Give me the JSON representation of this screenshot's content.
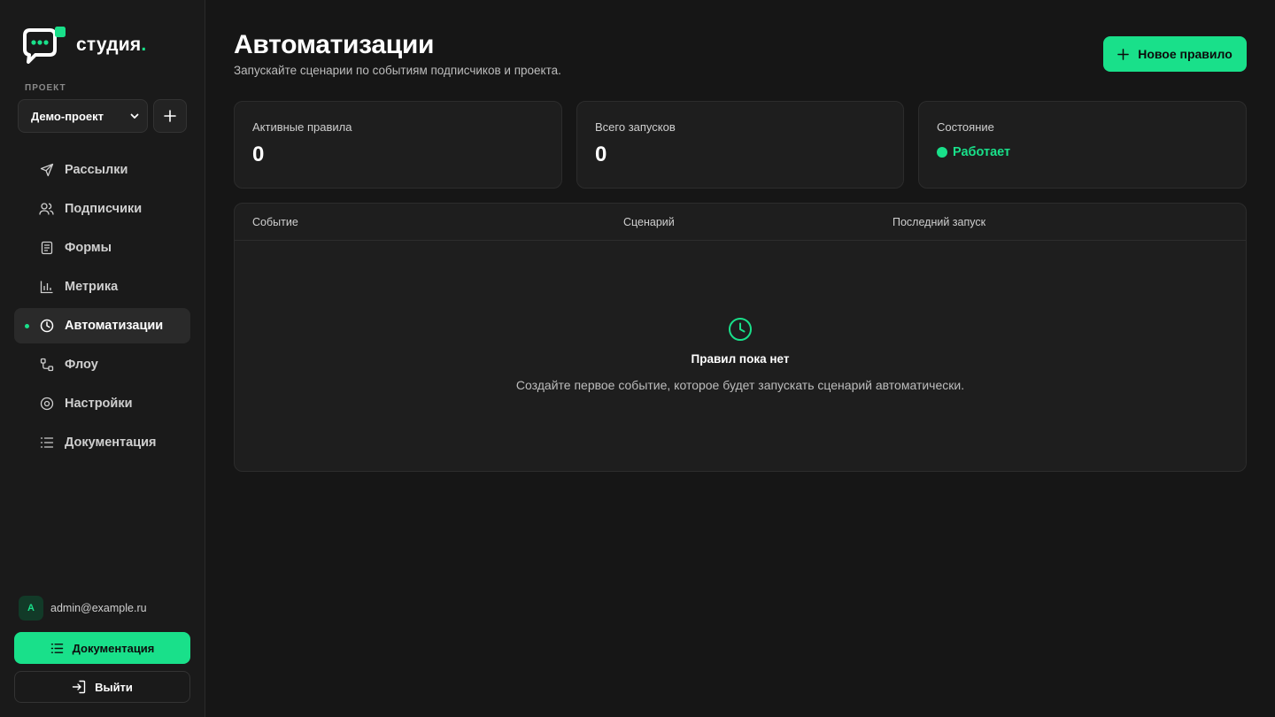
{
  "sidebar": {
    "logo_text": "студия",
    "logo_dot": ".",
    "project_label": "ПРОЕКТ",
    "project_selected": "Демо-проект",
    "nav": [
      {
        "label": "Рассылки",
        "icon": "send-icon"
      },
      {
        "label": "Подписчики",
        "icon": "users-icon"
      },
      {
        "label": "Формы",
        "icon": "form-icon"
      },
      {
        "label": "Метрика",
        "icon": "bar-chart-icon"
      },
      {
        "label": "Автоматизации",
        "icon": "clock-icon",
        "active": true
      },
      {
        "label": "Флоу",
        "icon": "flow-icon"
      },
      {
        "label": "Настройки",
        "icon": "settings-icon"
      },
      {
        "label": "Документация",
        "icon": "list-icon"
      }
    ],
    "user": {
      "initial": "A",
      "email": "admin@example.ru"
    },
    "docs_button": "Документация",
    "logout_button": "Выйти"
  },
  "header": {
    "title": "Автоматизации",
    "subtitle": "Запускайте сценарии по событиям подписчиков и проекта.",
    "new_rule_button": "Новое правило"
  },
  "stats": {
    "active_rules": {
      "label": "Активные правила",
      "value": "0"
    },
    "total_runs": {
      "label": "Всего запусков",
      "value": "0"
    },
    "state": {
      "label": "Состояние",
      "value": "Работает"
    }
  },
  "table": {
    "columns": [
      "Событие",
      "Сценарий",
      "Последний запуск"
    ],
    "empty_title": "Правил пока нет",
    "empty_text": "Создайте первое событие, которое будет запускать сценарий автоматически."
  },
  "colors": {
    "accent": "#19e08a",
    "background": "#161616",
    "sidebar": "#1a1a1a",
    "card": "#1e1e1e"
  }
}
